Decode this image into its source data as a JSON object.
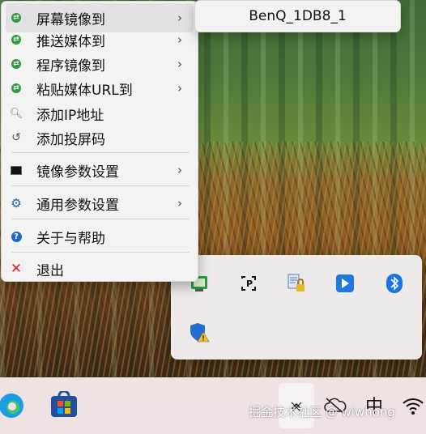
{
  "menu": {
    "items": [
      {
        "label": "屏幕镜像到",
        "icon": "mirror-green-icon",
        "has_submenu": true
      },
      {
        "label": "推送媒体到",
        "icon": "mirror-green-icon",
        "has_submenu": true
      },
      {
        "label": "程序镜像到",
        "icon": "mirror-green-icon",
        "has_submenu": true
      },
      {
        "label": "粘贴媒体URL到",
        "icon": "mirror-green-icon",
        "has_submenu": true
      },
      {
        "label": "添加IP地址",
        "icon": "key-icon",
        "has_submenu": false
      },
      {
        "label": "添加投屏码",
        "icon": "refresh-icon",
        "has_submenu": false
      },
      {
        "label": "镜像参数设置",
        "icon": "monitor-icon",
        "has_submenu": true
      },
      {
        "label": "通用参数设置",
        "icon": "gear-icon",
        "has_submenu": true
      },
      {
        "label": "关于与帮助",
        "icon": "help-icon",
        "has_submenu": false
      },
      {
        "label": "退出",
        "icon": "close-icon",
        "has_submenu": false
      }
    ]
  },
  "submenu": {
    "item": "BenQ_1DB8_1"
  },
  "taskbar": {
    "watermark": "掘金技术社区 @ wiwhong",
    "ime_label": "中"
  },
  "colors": {
    "menu_bg": "#f3f3f3",
    "highlight": "#e2e2e2",
    "taskbar_bg": "#efe2e2",
    "tray_bg": "#eeeaea",
    "blue_app": "#1f7ae0"
  }
}
